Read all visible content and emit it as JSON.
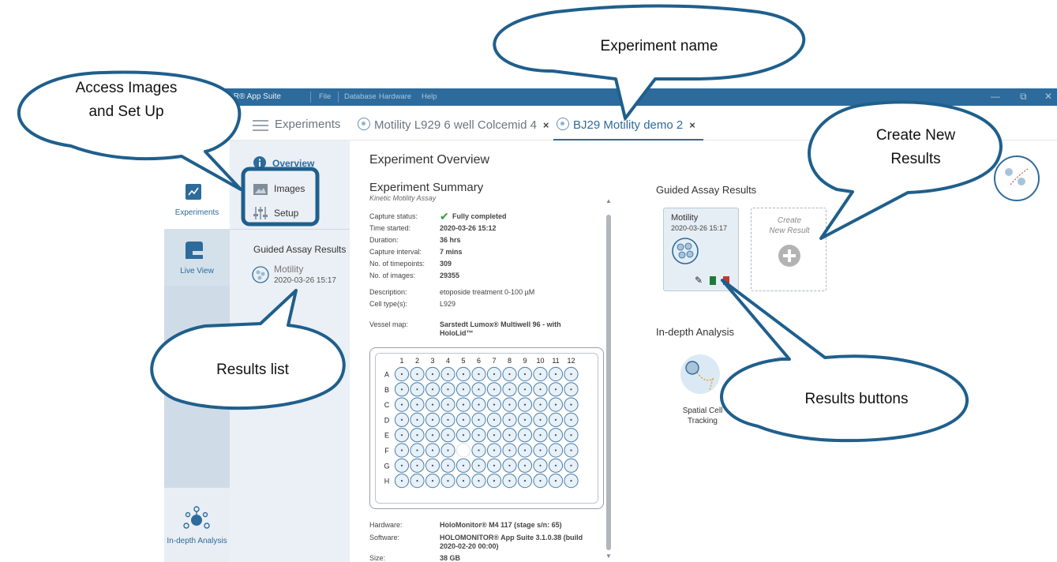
{
  "titlebar": {
    "app_title_fragment": "OR® App Suite",
    "menus": [
      "File",
      "Database",
      "Hardware",
      "Help"
    ]
  },
  "tabs": {
    "experiments": "Experiments",
    "tab1": "Motility L929 6 well Colcemid 4",
    "tab2": "BJ29 Motility demo 2",
    "close": "×"
  },
  "rail": {
    "experiments": "Experiments",
    "live_view": "Live View",
    "in_depth": "In-depth Analysis"
  },
  "subpanel": {
    "overview": "Overview",
    "images": "Images",
    "setup": "Setup",
    "guided_header": "Guided Assay Results",
    "result_name": "Motility",
    "result_date": "2020-03-26 15:17"
  },
  "main": {
    "title": "Experiment Overview",
    "summary_title": "Experiment Summary",
    "summary_sub": "Kinetic Motility Assay",
    "fields": [
      {
        "k": "Capture status:",
        "v": "Fully completed"
      },
      {
        "k": "Time started:",
        "v": "2020-03-26 15:12"
      },
      {
        "k": "Duration:",
        "v": "36 hrs"
      },
      {
        "k": "Capture interval:",
        "v": "7 mins"
      },
      {
        "k": "No. of timepoints:",
        "v": "309"
      },
      {
        "k": "No. of images:",
        "v": "29355"
      }
    ],
    "description_k": "Description:",
    "description_v": "etoposide treatment 0-100 µM",
    "celltype_k": "Cell type(s):",
    "celltype_v": "L929",
    "vessel_k": "Vessel map:",
    "vessel_v1": "Sarstedt Lumox® Multiwell 96 - with",
    "vessel_v2": "HoloLid™",
    "plate_cols": [
      "1",
      "2",
      "3",
      "4",
      "5",
      "6",
      "7",
      "8",
      "9",
      "10",
      "11",
      "12"
    ],
    "plate_rows": [
      "A",
      "B",
      "C",
      "D",
      "E",
      "F",
      "G",
      "H"
    ],
    "hardware_k": "Hardware:",
    "hardware_v": "HoloMonitor® M4 117 (stage s/n: 65)",
    "software_k": "Software:",
    "software_v1": "HOLOMONITOR® App Suite 3.1.0.38 (build",
    "software_v2": "2020-02-20 00:00)",
    "size_k": "Size:",
    "size_v": "38 GB"
  },
  "results": {
    "guided_title": "Guided Assay Results",
    "card_name": "Motility",
    "card_date": "2020-03-26 15:17",
    "new_line1": "Create",
    "new_line2": "New Result",
    "indepth_title": "In-depth Analysis",
    "spatial1": "Spatial Cell",
    "spatial2": "Tracking"
  },
  "callouts": {
    "experiment_name": "Experiment name",
    "access_images_1": "Access Images",
    "access_images_2": "and Set Up",
    "create_new_1": "Create New",
    "create_new_2": "Results",
    "results_list": "Results list",
    "results_buttons": "Results buttons"
  },
  "colors": {
    "brand_blue": "#2d6b9c",
    "callout_border": "#1f5f8c",
    "check_green": "#2e9e3c"
  }
}
